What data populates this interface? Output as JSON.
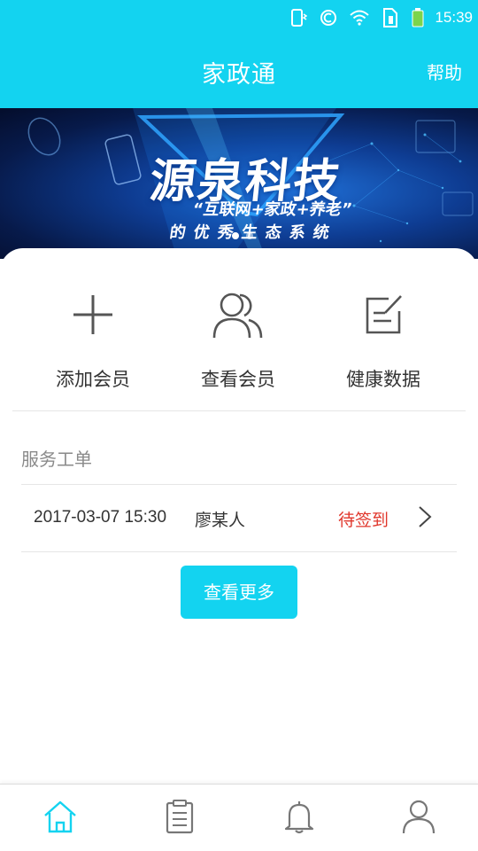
{
  "status_bar": {
    "time": "15:39",
    "icons": [
      "phone-vibrate-icon",
      "nfc-icon",
      "wifi-icon",
      "sim-icon",
      "battery-icon"
    ]
  },
  "header": {
    "title": "家政通",
    "help_label": "帮助"
  },
  "banner": {
    "title": "源泉科技",
    "subtitle_line1": "“互联网+家政+养老”",
    "subtitle_line2": "的优秀生态系统",
    "slides_count": 2,
    "active_slide": 1
  },
  "quick_actions": [
    {
      "label": "添加会员",
      "icon": "plus-icon"
    },
    {
      "label": "查看会员",
      "icon": "users-icon"
    },
    {
      "label": "健康数据",
      "icon": "edit-note-icon"
    }
  ],
  "service_orders": {
    "section_title": "服务工单",
    "rows": [
      {
        "datetime": "2017-03-07 15:30",
        "name": "廖某人",
        "status": "待签到"
      }
    ],
    "more_label": "查看更多"
  },
  "tab_bar": {
    "tabs": [
      {
        "icon": "home-icon",
        "active": true
      },
      {
        "icon": "clipboard-icon",
        "active": false
      },
      {
        "icon": "bell-icon",
        "active": false
      },
      {
        "icon": "user-icon",
        "active": false
      }
    ]
  },
  "colors": {
    "accent": "#13d3f0",
    "status_red": "#e0362b",
    "text_primary": "#333333",
    "text_secondary": "#8a8a8a"
  }
}
